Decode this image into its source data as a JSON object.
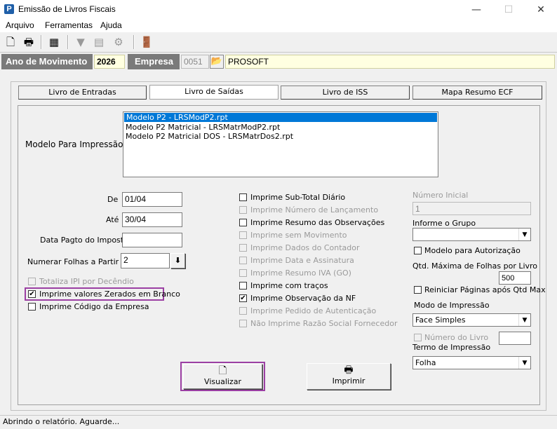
{
  "window": {
    "title": "Emissão de Livros Fiscais",
    "app_icon_letter": "P"
  },
  "menu": [
    "Arquivo",
    "Ferramentas",
    "Ajuda"
  ],
  "header": {
    "ano_label": "Ano de Movimento",
    "ano_value": "2026",
    "empresa_label": "Empresa",
    "empresa_code": "0051",
    "empresa_name": "PROSOFT"
  },
  "tabs": [
    "Livro de Entradas",
    "Livro de Saídas",
    "Livro de ISS",
    "Mapa Resumo ECF"
  ],
  "active_tab": "Livro de Saídas",
  "modelo": {
    "label": "Modelo Para Impressão",
    "items": [
      "Modelo P2 - LRSModP2.rpt",
      "Modelo P2 Matricial - LRSMatrModP2.rpt",
      "Modelo P2 Matricial DOS - LRSMatrDos2.rpt"
    ],
    "selected_index": 0
  },
  "left": {
    "de_label": "De",
    "de_value": "01/04",
    "ate_label": "Até",
    "ate_value": "30/04",
    "pagto_label": "Data Pagto do Imposto",
    "pagto_value": "",
    "numerar_label": "Numerar Folhas a Partir de",
    "numerar_value": "2",
    "totaliza_label": "Totaliza IPI por Decêndio",
    "zerados_label": "Imprime valores Zerados em Branco",
    "codigo_label": "Imprime Código da Empresa"
  },
  "middle_checks": [
    {
      "label": "Imprime Sub-Total Diário",
      "checked": false,
      "enabled": true
    },
    {
      "label": "Imprime Número de Lançamento",
      "checked": false,
      "enabled": false
    },
    {
      "label": "Imprime Resumo das Observações",
      "checked": false,
      "enabled": true
    },
    {
      "label": "Imprime sem Movimento",
      "checked": false,
      "enabled": false
    },
    {
      "label": "Imprime Dados do Contador",
      "checked": false,
      "enabled": false
    },
    {
      "label": "Imprime Data e Assinatura",
      "checked": false,
      "enabled": false
    },
    {
      "label": "Imprime Resumo IVA (GO)",
      "checked": false,
      "enabled": false
    },
    {
      "label": "Imprime com traços",
      "checked": false,
      "enabled": true
    },
    {
      "label": "Imprime Observação da NF",
      "checked": true,
      "enabled": true
    },
    {
      "label": "Imprime Pedido de Autenticação",
      "checked": false,
      "enabled": false
    },
    {
      "label": "Não Imprime Razão Social Fornecedor",
      "checked": false,
      "enabled": false
    }
  ],
  "right": {
    "numero_inicial_label": "Número Inicial",
    "numero_inicial_value": "1",
    "grupo_label": "Informe o Grupo",
    "grupo_value": "",
    "autorizacao_label": "Modelo para Autorização",
    "qtd_label": "Qtd. Máxima de Folhas por Livro",
    "qtd_value": "500",
    "reiniciar_label": "Reiniciar Páginas após Qtd Max",
    "modo_label": "Modo de Impressão",
    "modo_value": "Face Simples",
    "numero_livro_label": "Número do Livro",
    "numero_livro_value": "",
    "termo_label": "Termo de Impressão",
    "termo_value": "Folha"
  },
  "buttons": {
    "visualizar": "Visualizar",
    "imprimir": "Imprimir"
  },
  "status": "Abrindo o relatório. Aguarde..."
}
